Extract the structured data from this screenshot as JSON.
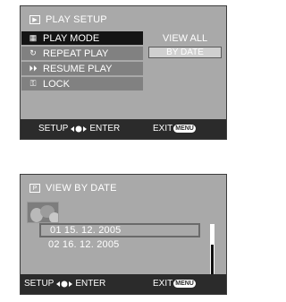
{
  "play_setup": {
    "title": "PLAY SETUP",
    "title_icon": "play-icon",
    "menu": [
      {
        "label": "PLAY MODE",
        "icon": "grid-icon",
        "selected": true
      },
      {
        "label": "REPEAT PLAY",
        "icon": "repeat-icon",
        "selected": false
      },
      {
        "label": "RESUME PLAY",
        "icon": "resume-icon",
        "selected": false
      },
      {
        "label": "LOCK",
        "icon": "key-icon",
        "selected": false
      }
    ],
    "submenu": {
      "current": "VIEW ALL",
      "option": "BY DATE"
    },
    "footer": {
      "setup": "SETUP",
      "enter": "ENTER",
      "exit": "EXIT",
      "menu_badge": "MENU"
    }
  },
  "view_by_date": {
    "title": "VIEW BY DATE",
    "title_icon": "p-icon",
    "dates": [
      {
        "index": "01",
        "date": "15. 12. 2005",
        "selected": true
      },
      {
        "index": "02",
        "date": "16. 12. 2005",
        "selected": false
      }
    ],
    "scroll_position_fraction": 0.4,
    "footer": {
      "setup": "SETUP",
      "enter": "ENTER",
      "exit": "EXIT",
      "menu_badge": "MENU"
    }
  },
  "colors": {
    "screen_bg": "#a9a9a9",
    "selected_bg": "#141414",
    "item_bg": "#818181",
    "footer_bg": "#2b2b2b"
  }
}
